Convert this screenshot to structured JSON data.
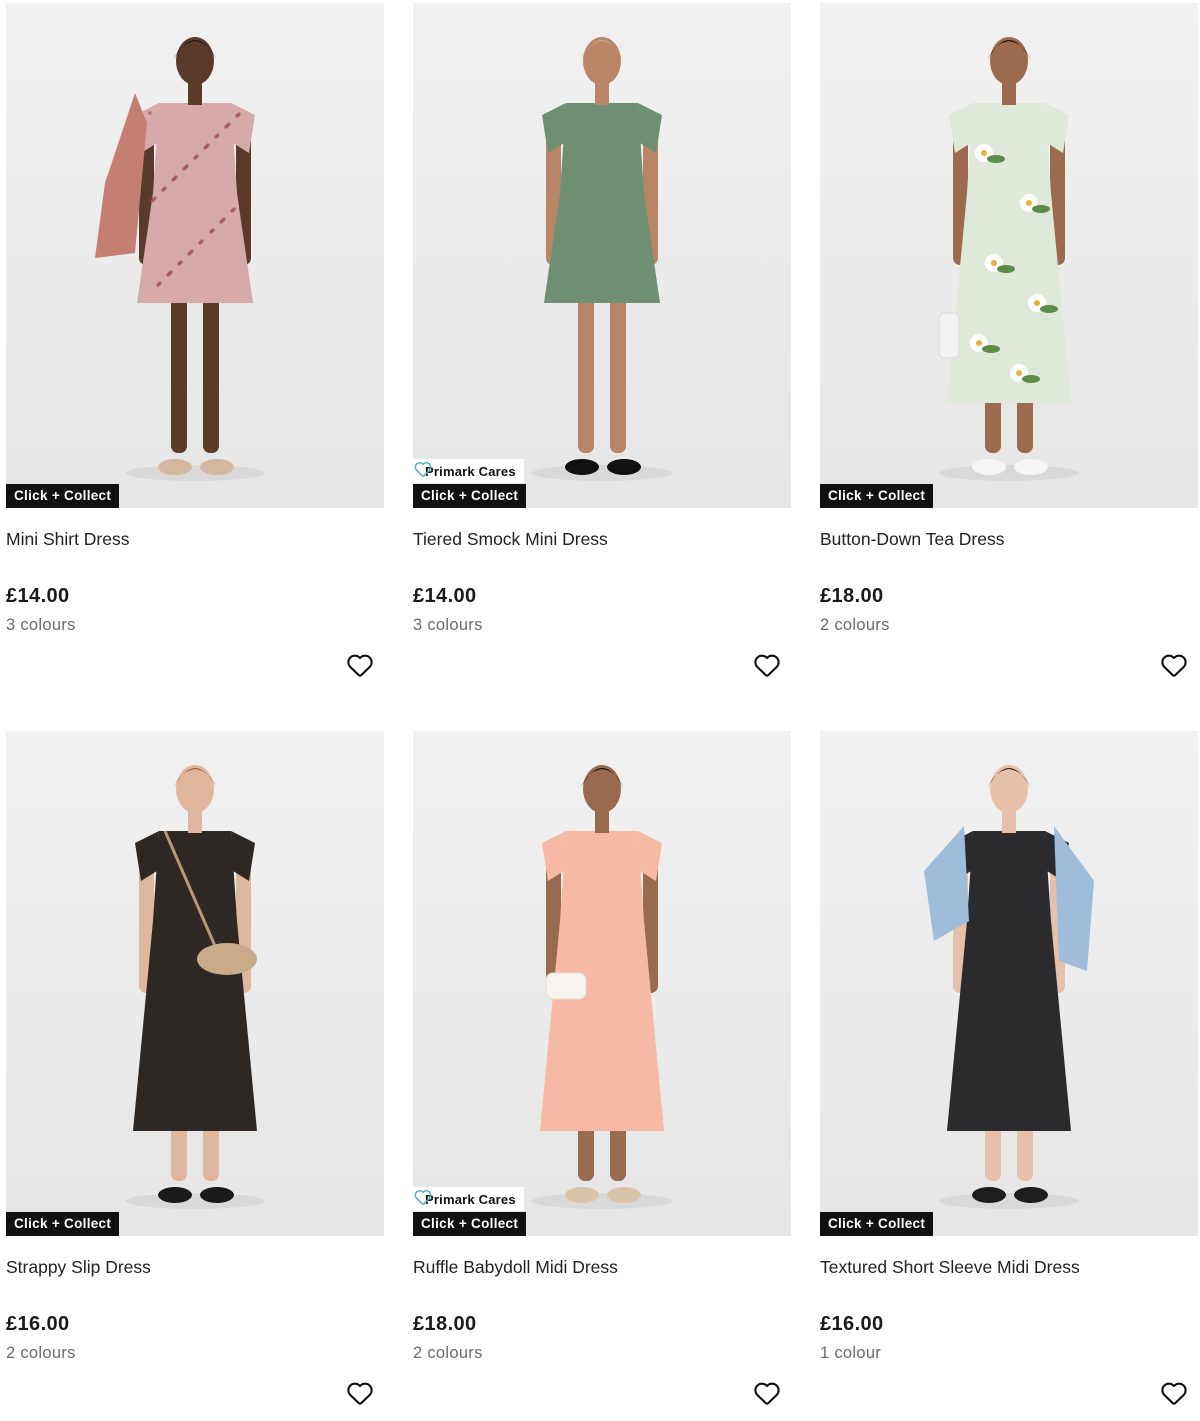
{
  "products": [
    {
      "name": "Mini Shirt Dress",
      "price": "£14.00",
      "colours": "3 colours",
      "badges": {
        "primark_cares": null,
        "click_collect": "Click + Collect"
      },
      "image": {
        "dress_color": "#d6a9ab",
        "pattern": "floral-small",
        "skin": "#5a3a2a",
        "hair": "#1a1a1a",
        "accessory": "pink-jacket",
        "accessory_color": "#c47f72",
        "shoes": "#d4b8a0"
      },
      "wishlist_icon": "heart-outline-icon"
    },
    {
      "name": "Tiered Smock Mini Dress",
      "price": "£14.00",
      "colours": "3 colours",
      "badges": {
        "primark_cares": "Primark Cares",
        "click_collect": "Click + Collect"
      },
      "image": {
        "dress_color": "#6f8f72",
        "pattern": "plain",
        "skin": "#b98566",
        "hair": "#c9a37a",
        "accessory": "none",
        "accessory_color": "#6f8f72",
        "shoes": "#111111"
      },
      "wishlist_icon": "heart-outline-icon"
    },
    {
      "name": "Button-Down Tea Dress",
      "price": "£18.00",
      "colours": "2 colours",
      "badges": {
        "primark_cares": null,
        "click_collect": "Click + Collect"
      },
      "image": {
        "dress_color": "#dfe9d9",
        "pattern": "floral-large",
        "skin": "#9c6a4c",
        "hair": "#111111",
        "accessory": "white-bag",
        "accessory_color": "#f2f2f2",
        "shoes": "#f5f5f5"
      },
      "wishlist_icon": "heart-outline-icon"
    },
    {
      "name": "Strappy Slip Dress",
      "price": "£16.00",
      "colours": "2 colours",
      "badges": {
        "primark_cares": null,
        "click_collect": "Click + Collect"
      },
      "image": {
        "dress_color": "#2e2824",
        "pattern": "plain",
        "skin": "#e0b79e",
        "hair": "#9b6238",
        "accessory": "beige-crossbody",
        "accessory_color": "#c9ab8c",
        "shoes": "#1a1a1a"
      },
      "wishlist_icon": "heart-outline-icon"
    },
    {
      "name": "Ruffle Babydoll Midi Dress",
      "price": "£18.00",
      "colours": "2 colours",
      "badges": {
        "primark_cares": "Primark Cares",
        "click_collect": "Click + Collect"
      },
      "image": {
        "dress_color": "#f6b9a6",
        "pattern": "plain",
        "skin": "#9a6a4e",
        "hair": "#111111",
        "accessory": "white-clutch",
        "accessory_color": "#f7f3ee",
        "shoes": "#d9c3a9"
      },
      "wishlist_icon": "heart-outline-icon"
    },
    {
      "name": "Textured Short Sleeve Midi Dress",
      "price": "£16.00",
      "colours": "1 colour",
      "badges": {
        "primark_cares": null,
        "click_collect": "Click + Collect"
      },
      "image": {
        "dress_color": "#2b2b2e",
        "pattern": "plain",
        "skin": "#e6c0a8",
        "hair": "#3b2a22",
        "accessory": "denim-jacket",
        "accessory_color": "#9fbcd8",
        "shoes": "#1e1e1e"
      },
      "wishlist_icon": "heart-outline-icon"
    }
  ],
  "colors": {
    "badge_collect_bg": "#111111",
    "badge_cares_heart": "#4fb3c9",
    "image_bg": "#eeeeee"
  }
}
